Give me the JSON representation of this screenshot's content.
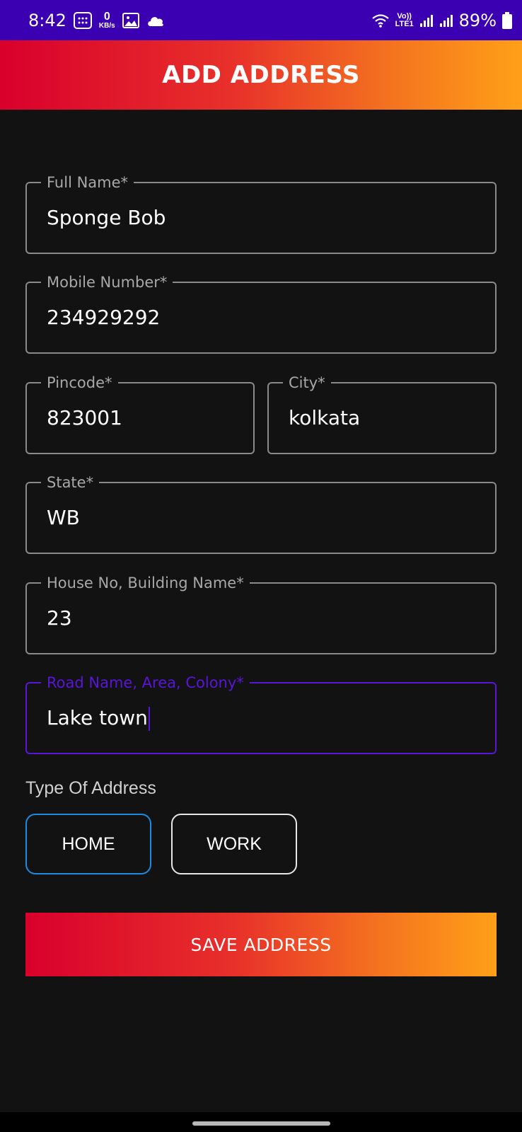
{
  "status_bar": {
    "time": "8:42",
    "data_speed_value": "0",
    "data_speed_unit": "KB/s",
    "network_label_top": "Vo))",
    "network_label_bottom": "LTE1",
    "battery_percent": "89%"
  },
  "header": {
    "title": "ADD ADDRESS"
  },
  "form": {
    "full_name": {
      "label": "Full Name*",
      "value": "Sponge Bob"
    },
    "mobile_number": {
      "label": "Mobile Number*",
      "value": "234929292"
    },
    "pincode": {
      "label": "Pincode*",
      "value": "823001"
    },
    "city": {
      "label": "City*",
      "value": "kolkata"
    },
    "state": {
      "label": "State*",
      "value": "WB"
    },
    "house": {
      "label": "House No, Building Name*",
      "value": "23"
    },
    "road": {
      "label": "Road Name, Area, Colony*",
      "value": "Lake town"
    }
  },
  "address_type": {
    "label": "Type Of Address",
    "options": [
      "HOME",
      "WORK"
    ],
    "selected": "HOME"
  },
  "save_button": {
    "label": "SAVE ADDRESS"
  },
  "colors": {
    "accent_focus": "#5a16d8",
    "selected_option_border": "#1c8ae0",
    "gradient_start": "#d9002c",
    "gradient_end": "#ffa018",
    "status_bar": "#3a00b2",
    "background": "#121212"
  },
  "icons": [
    "data-speed-icon",
    "gallery-icon",
    "cloud-icon",
    "wifi-icon",
    "signal-icon",
    "battery-icon"
  ]
}
